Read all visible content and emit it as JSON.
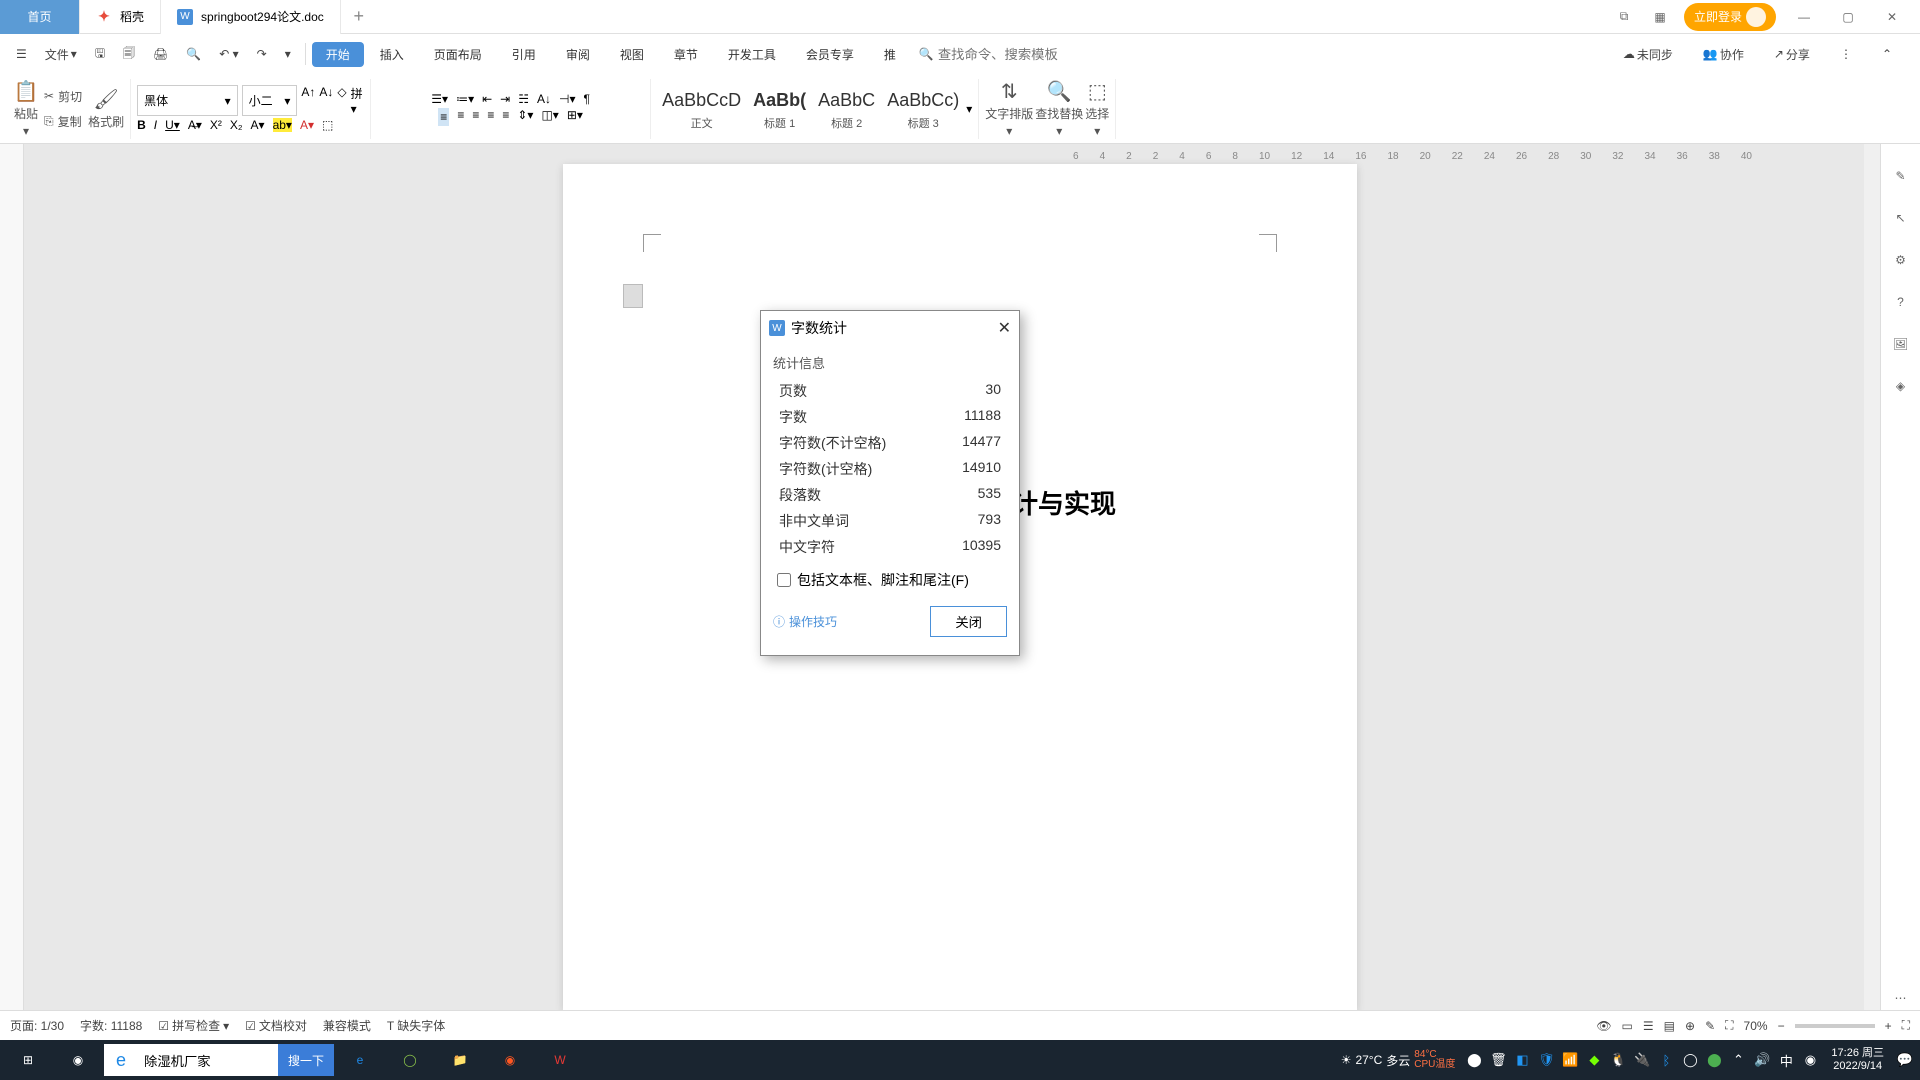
{
  "tabs": {
    "home": "首页",
    "doke": "稻壳",
    "doc": "springboot294论文.doc"
  },
  "titleRight": {
    "login": "立即登录"
  },
  "menu": {
    "file": "文件"
  },
  "ribbonTabs": [
    "开始",
    "插入",
    "页面布局",
    "引用",
    "审阅",
    "视图",
    "章节",
    "开发工具",
    "会员专享",
    "推"
  ],
  "search": {
    "placeholder": "查找命令、搜索模板"
  },
  "menuRight": {
    "unsync": "未同步",
    "collab": "协作",
    "share": "分享"
  },
  "toolbar": {
    "paste": "粘贴",
    "cut": "剪切",
    "copy": "复制",
    "format": "格式刷",
    "fontName": "黑体",
    "fontSize": "小二",
    "styles": [
      {
        "preview": "AaBbCcD",
        "label": "正文"
      },
      {
        "preview": "AaBb(",
        "label": "标题 1"
      },
      {
        "preview": "AaBbC",
        "label": "标题 2"
      },
      {
        "preview": "AaBbCc)",
        "label": "标题 3"
      }
    ],
    "textSort": "文字排版",
    "findReplace": "查找替换",
    "select": "选择"
  },
  "document": {
    "title": "火车票订票系统设计与实现"
  },
  "dialog": {
    "title": "字数统计",
    "section": "统计信息",
    "rows": [
      {
        "label": "页数",
        "value": "30"
      },
      {
        "label": "字数",
        "value": "11188"
      },
      {
        "label": "字符数(不计空格)",
        "value": "14477"
      },
      {
        "label": "字符数(计空格)",
        "value": "14910"
      },
      {
        "label": "段落数",
        "value": "535"
      },
      {
        "label": "非中文单词",
        "value": "793"
      },
      {
        "label": "中文字符",
        "value": "10395"
      }
    ],
    "checkbox": "包括文本框、脚注和尾注(F)",
    "tips": "操作技巧",
    "close": "关闭"
  },
  "statusbar": {
    "page": "页面: 1/30",
    "words": "字数: 11188",
    "spell": "拼写检查",
    "proof": "文档校对",
    "compat": "兼容模式",
    "missingFont": "缺失字体",
    "zoom": "70%"
  },
  "taskbar": {
    "searchText": "除湿机厂家",
    "searchBtn": "搜一下",
    "weather": {
      "temp": "27°C",
      "desc": "多云",
      "cpu": "84°C",
      "cpuLabel": "CPU温度"
    },
    "ime": "中",
    "time": "17:26 周三",
    "date": "2022/9/14"
  },
  "rulerTicks": [
    "6",
    "4",
    "2",
    "2",
    "4",
    "6",
    "8",
    "10",
    "12",
    "14",
    "16",
    "18",
    "20",
    "22",
    "24",
    "26",
    "28",
    "30",
    "32",
    "34",
    "36",
    "38",
    "40"
  ]
}
